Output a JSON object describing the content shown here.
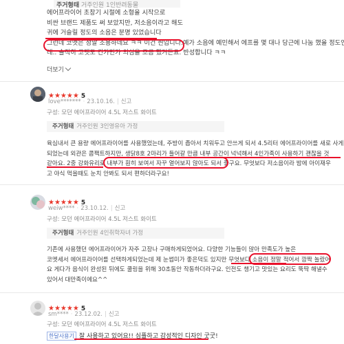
{
  "review0": {
    "header_label": "주거형태",
    "header_value": "거주인원 1인반려동물",
    "lines": [
      "에어프라이어 초창기 시절에 소형을 시작으로",
      "비싼 브랜드 제품도 써 보았지만, 저소음이라고 해도",
      "귀에 거슬릴 정도의 소음은 분명 있었습니다",
      "그런데 코멧은 정말 조용하네요 ㅋㅋ 이건 찐입니다. ",
      "예가 소음에 예민해서 에프를 몇 대나 당근에 나눔 했을 정도인",
      "데.. 솔직히 코멧도 긴가민가 의심을 조금 했거든요. 반성합니다 ㅋㅋ"
    ],
    "more_label": "더보기"
  },
  "reviews": [
    {
      "score": "5",
      "stars": "★★★★★",
      "user": "love*******",
      "date": "23.10.16.",
      "report": "신고",
      "option": "구성: 모던 에어프라이어 4.5L 저스트 화이트",
      "info_label": "주거형태",
      "info_value": "거주인원 3인영유아 가정",
      "lines": [
        "육심내서 큰 용량 에어프라이어를 사용했었는데, 주방이 좁아서 치워두고 안쓰게 되서 4.5리터 에어프라이어를 새로 사게",
        "되었는데 외관은 콤팩트하지만, 생닭8호 2마리가 들어갈 만큼 내부 공간이 넉넉해서 4인가족이 사용하기 괜찮을 것",
        "같아요. 2중 강화유리로 내부가 훤히 보여서 자꾸 열어보지 않아도 되서 좋구요. 무엇보다 저소음이라 밤에 아이재우",
        "고 야식 먹을때도 눈치 안봐도 되서 편하더라구요!"
      ]
    },
    {
      "score": "5",
      "stars": "★★★★★",
      "user": "weiw****",
      "date": "23.10.12.",
      "report": "신고",
      "option": "구성: 모던 에어프라이어 4.5L 저스트 화이트",
      "info_label": "주거형태",
      "info_value": "거주인원 4인취학자녀 가정",
      "lines": [
        "기존에 사용했던 에어프라이어가 자주 고장나 구매하게되었어요. 다양한 기능들이 많아 만족도가 높은",
        "코멧세서 에어프라이어를 선택하게되었는데 제 눈썹미가 좋은덕도 있지만 무엇보다 소음이 정말 적어서 깜짝 놀랐어",
        "요 게다가 음식이 완성된 뒤에도 쿨링을 위해 30초동안 작동하더라구요. 인전도 챙기고 맛있는 요리도 뚝딱 해낼수",
        "있어서 대만족이에요^^"
      ]
    },
    {
      "score": "5",
      "stars": "★★★★★",
      "user": "sm****",
      "date": "23.12.02.",
      "report": "신고",
      "option": "구성: 모던 에어프라이어 4.5L 저스트 화이트",
      "tag": "한달사용기",
      "line": "잘 사용하고 있어요!! 심플하고 감성적인 디자인 굿굿!"
    }
  ]
}
